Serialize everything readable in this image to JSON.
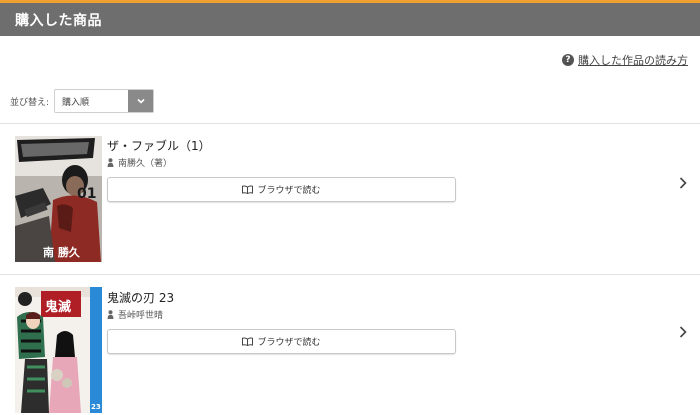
{
  "header": {
    "title": "購入した商品"
  },
  "help": {
    "icon": "question-circle-icon",
    "label": "購入した作品の読み方"
  },
  "sort": {
    "label": "並び替え:",
    "selected": "購入順",
    "icon": "chevron-down-icon"
  },
  "items": [
    {
      "title": "ザ・ファブル（1）",
      "author": "南勝久（著）",
      "read_label": "ブラウザで読む",
      "cover_text": "南 勝久"
    },
    {
      "title": "鬼滅の刃 23",
      "author": "吾峠呼世晴",
      "read_label": "ブラウザで読む",
      "cover_text": "23"
    }
  ],
  "colors": {
    "header_bg": "#6e6e6e",
    "header_accent": "#f0a030",
    "cover2_spine": "#2a8ad8"
  }
}
